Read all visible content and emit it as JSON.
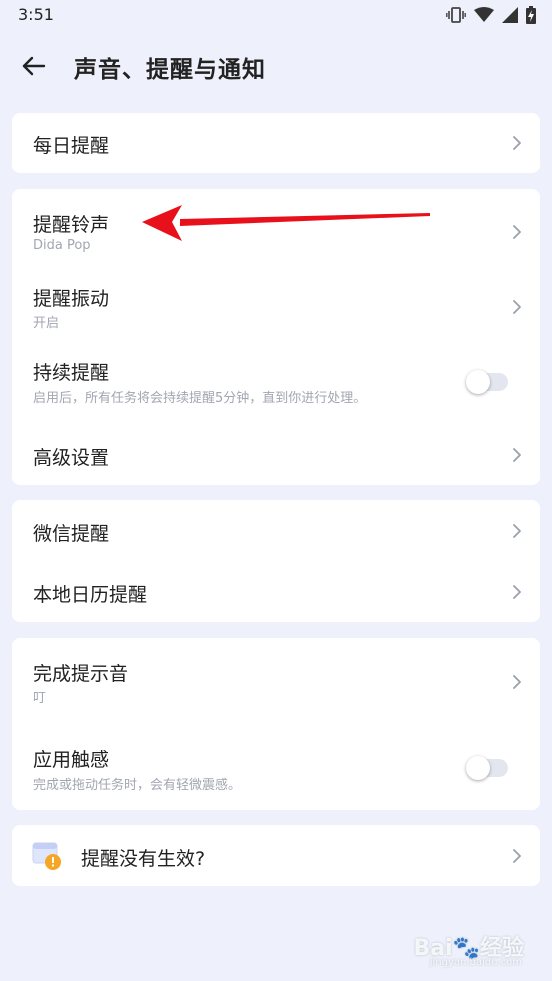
{
  "status_bar": {
    "time": "3:51"
  },
  "header": {
    "title": "声音、提醒与通知"
  },
  "groups": {
    "daily": {
      "daily_reminder": "每日提醒"
    },
    "reminder": {
      "ringtone_label": "提醒铃声",
      "ringtone_value": "Dida Pop",
      "vibration_label": "提醒振动",
      "vibration_value": "开启",
      "persistent_label": "持续提醒",
      "persistent_desc": "启用后，所有任务将会持续提醒5分钟，直到你进行处理。",
      "persistent_on": false,
      "advanced_label": "高级设置"
    },
    "integrations": {
      "wechat_label": "微信提醒",
      "calendar_label": "本地日历提醒"
    },
    "feedback": {
      "sound_label": "完成提示音",
      "sound_value": "叮",
      "haptic_label": "应用触感",
      "haptic_desc": "完成或拖动任务时，会有轻微震感。",
      "haptic_on": false
    },
    "help": {
      "not_working_label": "提醒没有生效?"
    }
  },
  "watermark": {
    "brand": "Bai🐾经验",
    "url": "jingyan.baidu.com"
  },
  "colors": {
    "background": "#eef1fb",
    "card": "#ffffff",
    "annotation_arrow": "#e8101a",
    "warning_badge": "#f5a623",
    "toggle_off": "#e3e6ee"
  },
  "icons": [
    "back-arrow-icon",
    "chevron-right-icon",
    "vibrate-icon",
    "wifi-icon",
    "signal-icon",
    "battery-icon",
    "reminder-warning-icon"
  ]
}
